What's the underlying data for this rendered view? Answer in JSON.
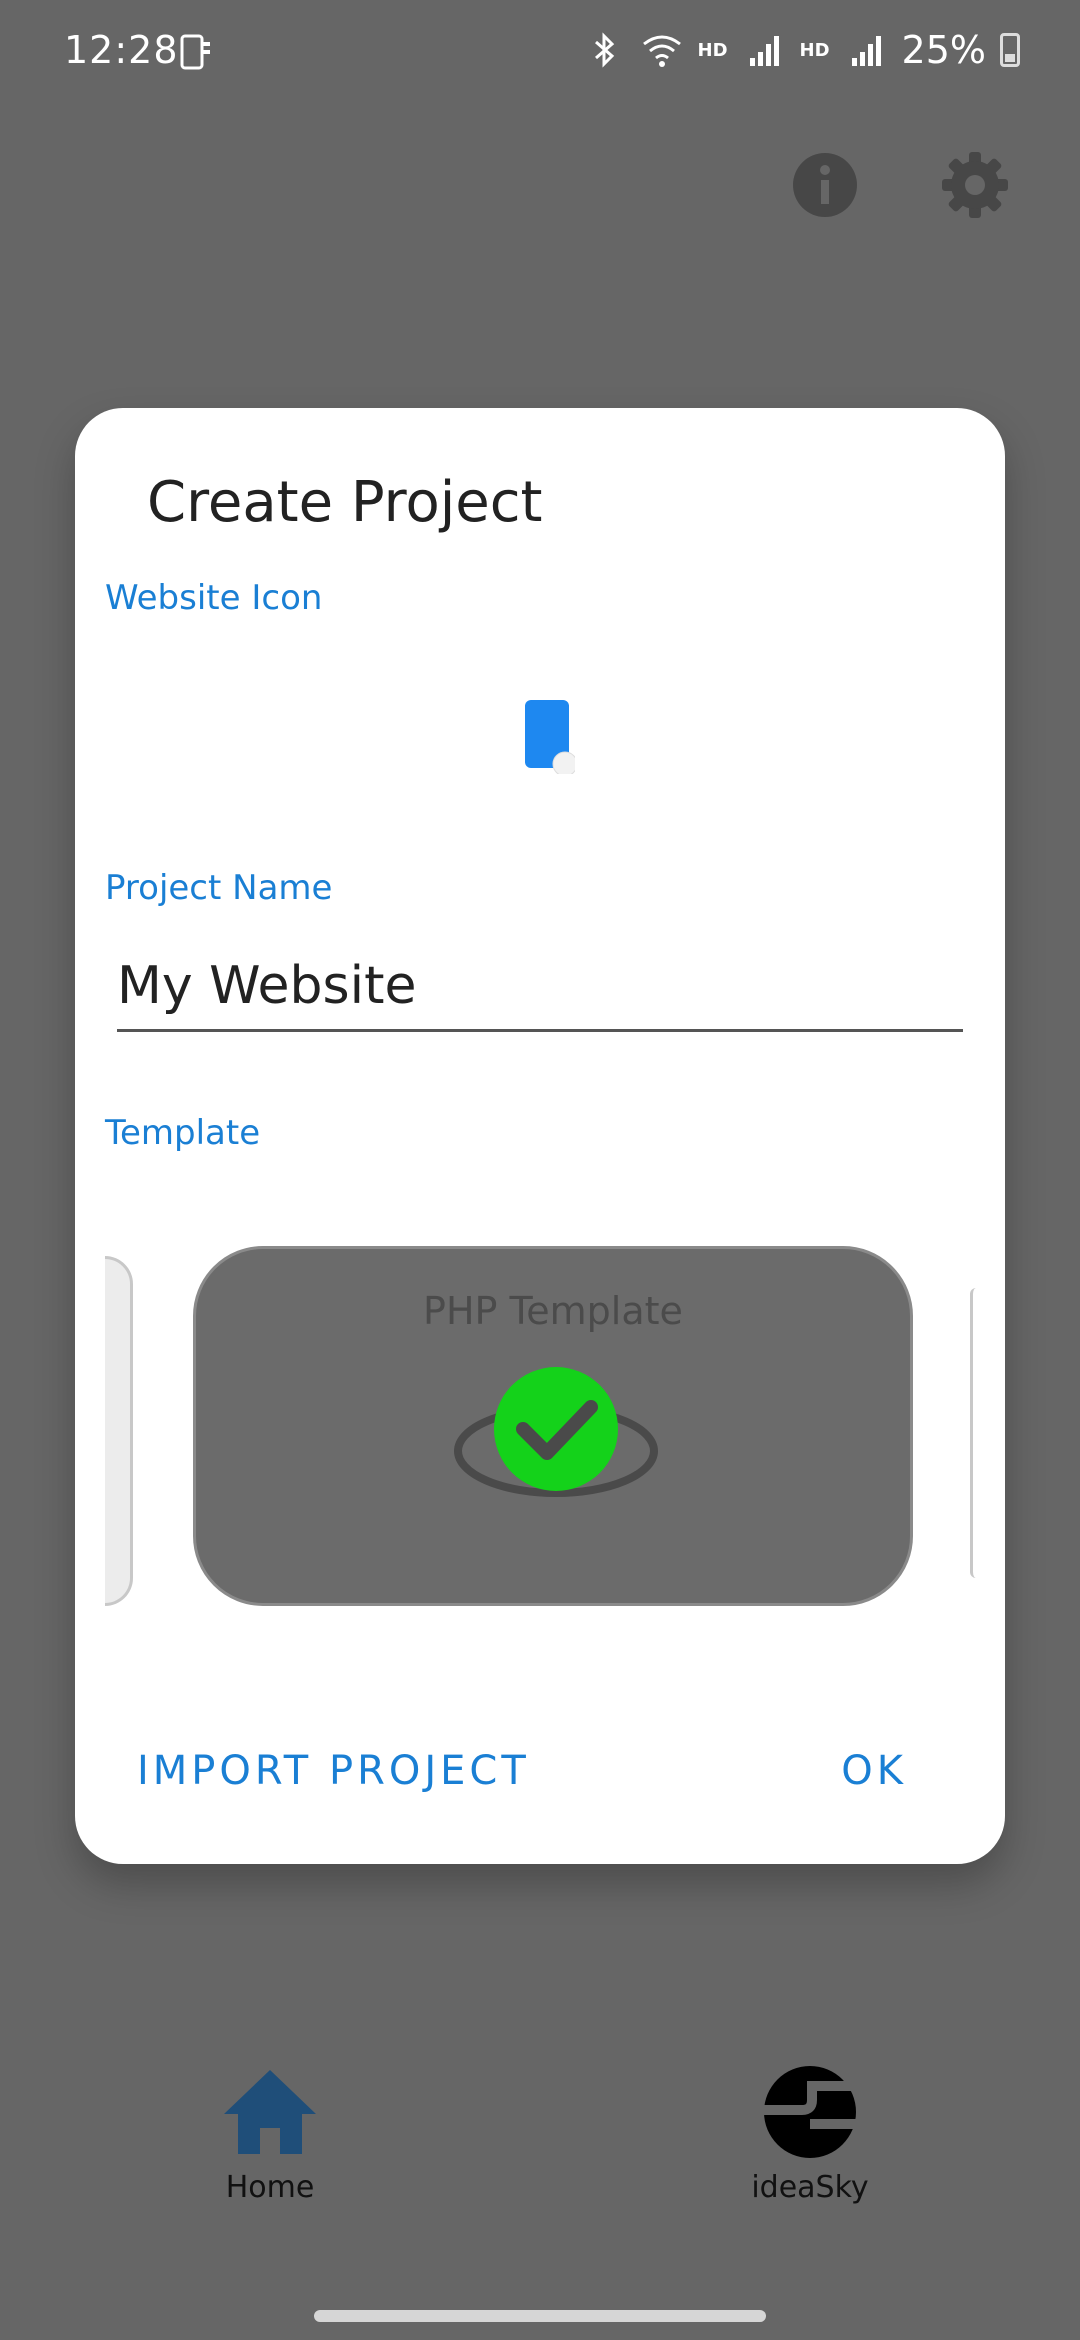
{
  "status": {
    "time": "12:28",
    "hd1": "HD",
    "hd2": "HD",
    "battery": "25%"
  },
  "dialog": {
    "title": "Create Project",
    "website_icon_label": "Website Icon",
    "project_name_label": "Project Name",
    "project_name_value": "My Website",
    "template_label": "Template",
    "template_selected": "PHP Template",
    "import_label": "IMPORT PROJECT",
    "ok_label": "OK"
  },
  "nav": {
    "home_label": "Home",
    "ideasky_label": "ideaSky"
  },
  "colors": {
    "accent": "#1a7fd4",
    "check_green": "#14d21a",
    "scrim": "#666666",
    "home_icon": "#1f4e79"
  },
  "icons": [
    "phone-status-icon",
    "bluetooth-icon",
    "wifi-icon",
    "signal-icon",
    "battery-icon",
    "info-icon",
    "gear-icon",
    "website-icon",
    "checkmark-icon",
    "home-icon",
    "ideasky-icon"
  ]
}
